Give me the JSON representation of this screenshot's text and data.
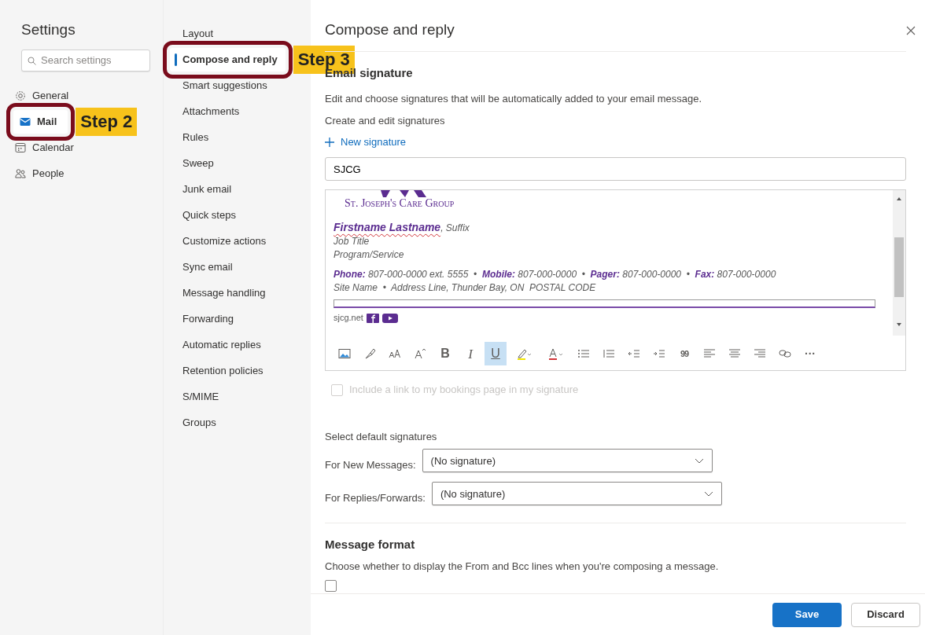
{
  "sidebar": {
    "title": "Settings",
    "search": {
      "placeholder": "Search settings"
    },
    "items": [
      {
        "label": "General",
        "selected": false
      },
      {
        "label": "Mail",
        "selected": true,
        "callout": "Step 2"
      },
      {
        "label": "Calendar",
        "selected": false
      },
      {
        "label": "People",
        "selected": false
      }
    ]
  },
  "subnav": {
    "items": [
      {
        "label": "Layout",
        "selected": false
      },
      {
        "label": "Compose and reply",
        "selected": true,
        "callout": "Step 3"
      },
      {
        "label": "Smart suggestions",
        "selected": false
      },
      {
        "label": "Attachments",
        "selected": false
      },
      {
        "label": "Rules",
        "selected": false
      },
      {
        "label": "Sweep",
        "selected": false
      },
      {
        "label": "Junk email",
        "selected": false
      },
      {
        "label": "Quick steps",
        "selected": false
      },
      {
        "label": "Customize actions",
        "selected": false
      },
      {
        "label": "Sync email",
        "selected": false
      },
      {
        "label": "Message handling",
        "selected": false
      },
      {
        "label": "Forwarding",
        "selected": false
      },
      {
        "label": "Automatic replies",
        "selected": false
      },
      {
        "label": "Retention policies",
        "selected": false
      },
      {
        "label": "S/MIME",
        "selected": false
      },
      {
        "label": "Groups",
        "selected": false
      }
    ]
  },
  "panel": {
    "title": "Compose and reply",
    "signature": {
      "heading": "Email signature",
      "description": "Edit and choose signatures that will be automatically added to your email message.",
      "create_label": "Create and edit signatures",
      "new_button": "New signature",
      "name_value": "SJCG",
      "editor": {
        "logo_text": "St. Joseph's Care Group",
        "name": "Firstname Lastname",
        "suffix": ", Suffix",
        "job_title": "Job Title",
        "program": "Program/Service",
        "contact": "**Phone:** 807-000-0000 ext. 5555  •  **Mobile:** 807-000-0000  •  **Pager:** 807-000-0000  •  **Fax:** 807-000-0000",
        "address": "Site Name  •  Address Line, Thunder Bay, ON  POSTAL CODE",
        "website": "sjcg.net"
      },
      "toolbar": [
        {
          "kind": "image",
          "selected": false
        },
        {
          "kind": "painter",
          "selected": false
        },
        {
          "kind": "fontsize",
          "selected": false
        },
        {
          "kind": "grow",
          "selected": false
        },
        {
          "kind": "bold",
          "text": "B",
          "selected": false
        },
        {
          "kind": "italic",
          "text": "I",
          "selected": false
        },
        {
          "kind": "underline",
          "text": "U",
          "selected": true
        },
        {
          "kind": "highlight",
          "selected": false
        },
        {
          "kind": "fontcolor",
          "selected": false
        },
        {
          "kind": "bullets",
          "selected": false
        },
        {
          "kind": "numbering",
          "selected": false
        },
        {
          "kind": "outdent",
          "selected": false
        },
        {
          "kind": "indent",
          "selected": false
        },
        {
          "kind": "quote",
          "text": "99",
          "selected": false
        },
        {
          "kind": "alignleft",
          "selected": false
        },
        {
          "kind": "aligncenter",
          "selected": false
        },
        {
          "kind": "alignright",
          "selected": false
        },
        {
          "kind": "link",
          "selected": false
        },
        {
          "kind": "more",
          "text": "···",
          "selected": false
        }
      ],
      "bookings": {
        "label": "Include a link to my bookings page in my signature",
        "checked": false,
        "disabled": true
      }
    },
    "defaults": {
      "heading": "Select default signatures",
      "rows": [
        {
          "label": "For New Messages:",
          "value": "(No signature)"
        },
        {
          "label": "For Replies/Forwards:",
          "value": "(No signature)"
        }
      ]
    },
    "message_format": {
      "heading": "Message format",
      "description": "Choose whether to display the From and Bcc lines when you're composing a message.",
      "checkbox_checked": false
    }
  },
  "footer": {
    "buttons": [
      {
        "label": "Save",
        "kind": "primary"
      },
      {
        "label": "Discard",
        "kind": "secondary"
      }
    ]
  }
}
